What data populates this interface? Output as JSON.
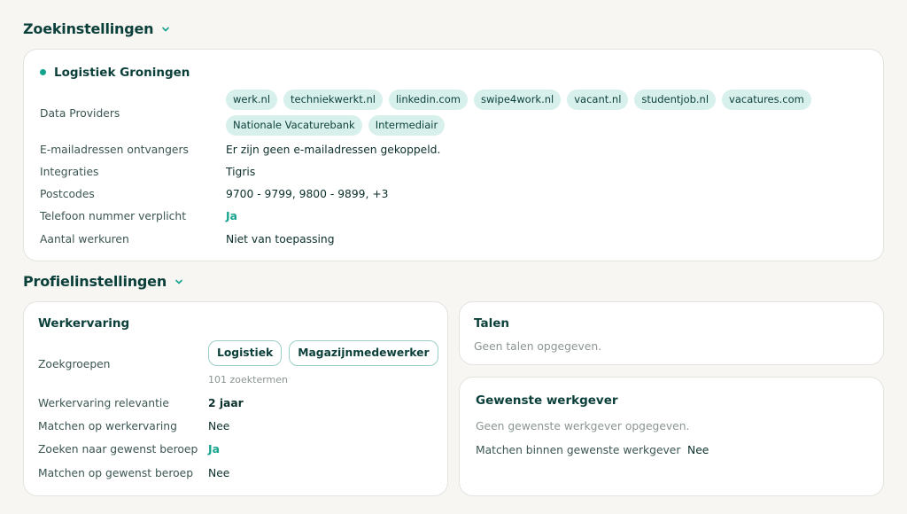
{
  "zoek": {
    "title": "Zoekinstellingen",
    "card_title": "Logistiek Groningen",
    "data_providers_label": "Data Providers",
    "data_providers": [
      "werk.nl",
      "techniekwerkt.nl",
      "linkedin.com",
      "swipe4work.nl",
      "vacant.nl",
      "studentjob.nl",
      "vacatures.com",
      "Nationale Vacaturebank",
      "Intermediair"
    ],
    "rows": [
      {
        "label": "E-mailadressen ontvangers",
        "value": "Er zijn geen e-mailadressen gekoppeld."
      },
      {
        "label": "Integraties",
        "value": "Tigris"
      },
      {
        "label": "Postcodes",
        "value": "9700 - 9799, 9800 - 9899, +3"
      },
      {
        "label": "Telefoon nummer verplicht",
        "value": "Ja"
      },
      {
        "label": "Aantal werkuren",
        "value": "Niet van toepassing"
      }
    ]
  },
  "profiel": {
    "title": "Profielinstellingen",
    "werkervaring": {
      "title": "Werkervaring",
      "zoekgroepen_label": "Zoekgroepen",
      "zoekgroepen": [
        "Logistiek",
        "Magazijnmedewerker"
      ],
      "zoektermen": "101 zoektermen",
      "rows": [
        {
          "label": "Werkervaring relevantie",
          "value": "2 jaar"
        },
        {
          "label": "Matchen op werkervaring",
          "value": "Nee"
        },
        {
          "label": "Zoeken naar gewenst beroep",
          "value": "Ja"
        },
        {
          "label": "Matchen op gewenst beroep",
          "value": "Nee"
        }
      ]
    },
    "talen": {
      "title": "Talen",
      "empty": "Geen talen opgegeven."
    },
    "werkgever": {
      "title": "Gewenste werkgever",
      "empty": "Geen gewenste werkgever opgegeven.",
      "match_label": "Matchen binnen gewenste werkgever",
      "match_value": "Nee"
    }
  },
  "colors": {
    "accent": "#16a38e",
    "chip_bg": "#d7f0ec",
    "title": "#0b3f3a"
  }
}
